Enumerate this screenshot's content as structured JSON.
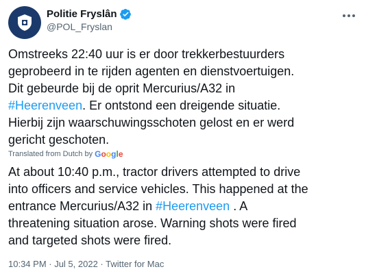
{
  "account": {
    "name": "Politie Fryslân",
    "handle": "@POL_Fryslan",
    "avatar_icon": "police-badge-icon",
    "verified_icon": "verified-badge-icon"
  },
  "more_icon": "more-options-icon",
  "tweet": {
    "line1": "Omstreeks 22:40 uur is er door trekkerbestuurders",
    "line2": "geprobeerd in te rijden agenten en dienstvoertuigen.",
    "line3": "Dit gebeurde bij de oprit Mercurius/A32 in",
    "hashtag": "#Heerenveen",
    "line4_rest": ". Er ontstond een dreigende situatie.",
    "line5": "Hierbij zijn waarschuwingsschoten gelost en er werd",
    "line6": "gericht geschoten."
  },
  "translation": {
    "label": "Translated from Dutch by",
    "provider": "Google",
    "line1": "At about 10:40 p.m., tractor drivers attempted to drive",
    "line2": "into officers and service vehicles. This happened at the",
    "line3_start": "entrance Mercurius/A32 in ",
    "hashtag": "#Heerenveen",
    "line3_end": " . A",
    "line4": "threatening situation arose. Warning shots were fired",
    "line5": "and targeted shots were fired."
  },
  "meta": "10:34 PM · Jul 5, 2022 · Twitter for Mac",
  "colors": {
    "link": "#1d9bf0",
    "text": "#0f1419",
    "secondary": "#536471",
    "avatar_bg": "#1b3a6b"
  }
}
